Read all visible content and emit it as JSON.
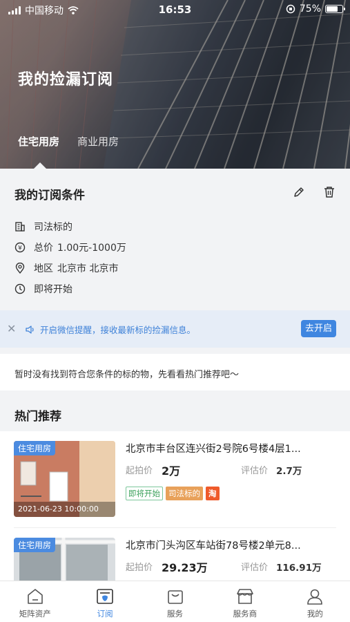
{
  "status": {
    "carrier": "中国移动",
    "time": "16:53",
    "battery": "75%",
    "battery_level": 0.75
  },
  "hero": {
    "title": "我的捡漏订阅",
    "tabs": [
      {
        "label": "住宅用房",
        "active": true
      },
      {
        "label": "商业用房",
        "active": false
      }
    ]
  },
  "subscription": {
    "title": "我的订阅条件",
    "conditions": {
      "type": {
        "text": "司法标的"
      },
      "price": {
        "label": "总价",
        "value": "1.00元-1000万"
      },
      "region": {
        "label": "地区",
        "value": "北京市 北京市"
      },
      "status": {
        "text": "即将开始"
      }
    }
  },
  "notice": {
    "text": "开启微信提醒，接收最新标的捡漏信息。",
    "button": "去开启"
  },
  "empty_text": "暂时没有找到符合您条件的标的物，先看看热门推荐吧～",
  "hot": {
    "title": "热门推荐",
    "items": [
      {
        "tag": "住宅用房",
        "date": "2021-06-23 10:00:00",
        "name": "北京市丰台区连兴街2号院6号楼4层1...",
        "start_label": "起拍价",
        "start_value": "2万",
        "eval_label": "评估价",
        "eval_value": "2.7万",
        "badges": [
          "即将开始",
          "司法标的",
          "淘"
        ]
      },
      {
        "tag": "住宅用房",
        "date": "",
        "name": "北京市门头沟区车站街78号楼2单元8...",
        "start_label": "起拍价",
        "start_value": "29.23万",
        "eval_label": "评估价",
        "eval_value": "116.91万",
        "badges": []
      }
    ]
  },
  "tabbar": [
    {
      "label": "矩阵资产",
      "icon": "home-icon",
      "active": false
    },
    {
      "label": "订阅",
      "icon": "subscribe-icon",
      "active": true
    },
    {
      "label": "服务",
      "icon": "bag-icon",
      "active": false
    },
    {
      "label": "服务商",
      "icon": "store-icon",
      "active": false
    },
    {
      "label": "我的",
      "icon": "user-icon",
      "active": false
    }
  ],
  "colors": {
    "accent": "#3f86e0",
    "notice_bg": "#e6edf7",
    "tag_blue": "#4b8be0"
  }
}
